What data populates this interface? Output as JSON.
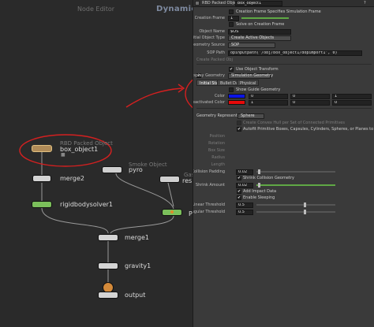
{
  "network": {
    "path_label": "Node Editor",
    "context_label": "Dynamics",
    "nodes": {
      "box_object": {
        "type": "RBD Packed Object",
        "name": "box_object1"
      },
      "smoke": {
        "type": "Smoke Object",
        "name": "pyro"
      },
      "resize": {
        "type": "Gas Re",
        "name": "resiz"
      },
      "merge2": {
        "name": "merge2"
      },
      "solver": {
        "name": "rigidbodysolver1"
      },
      "merge1": {
        "name": "merge1"
      },
      "gravity": {
        "name": "gravity1"
      },
      "output": {
        "name": "output"
      },
      "pyrosolver": {
        "name": "Py"
      }
    },
    "highlight_color": "#d42020",
    "solver_color": "#7bbf5b",
    "node_color": "#d4d4d4"
  },
  "panel": {
    "header": {
      "type_label": "RBD Packed Object",
      "node_name": "box_object1"
    },
    "creation_frame_toggle": "Creation Frame Specifies Simulation Frame",
    "creation_frame": {
      "label": "Creation Frame",
      "value": "1"
    },
    "solve_on_creation": "Solve on Creation Frame",
    "object_name": {
      "label": "Object Name",
      "value": "$OS"
    },
    "initial_object_type": {
      "label": "Initial Object Type",
      "value": "Create Active Objects"
    },
    "geometry_source": {
      "label": "Geometry Source",
      "value": "SOP"
    },
    "sop_path": {
      "label": "SOP Path",
      "value": "opinputpath('/obj/box_object1/dopimport1', 0)"
    },
    "create_from_label": "Create Packed Obj",
    "use_object_transform": "Use Object Transform",
    "display_geometry": {
      "label": "Display Geometry",
      "value": "Simulation Geometry"
    },
    "tabs": [
      "Initial State",
      "Bullet Data",
      "Physical"
    ],
    "show_guide": "Show Guide Geometry",
    "color": {
      "label": "Color",
      "values": [
        "0",
        "0",
        "1"
      ],
      "swatch": "#0a14e6"
    },
    "deactivated_color": {
      "label": "Deactivated Color",
      "values": [
        "1",
        "0",
        "0"
      ],
      "swatch": "#e60a0a"
    },
    "geometry_representation": {
      "label": "Geometry Representa",
      "value": "Sphere"
    },
    "convex_note": "Create Convex Hull per Set of Connected Primitives",
    "autofit_note": "Autofit Primitive Boxes, Capsules, Cylinders, Spheres, or Planes to Geometry",
    "dim_rows": [
      "Position",
      "Rotation",
      "Box Size",
      "Radius",
      "Length"
    ],
    "collision_padding": {
      "label": "Collision Padding",
      "value": "0.02"
    },
    "shrink_geometry": "Shrink Collision Geometry",
    "shrink_amount": {
      "label": "Shrink Amount",
      "value": "0.02"
    },
    "add_impact": "Add Impact Data",
    "enable_sleeping": "Enable Sleeping",
    "linear_threshold": {
      "label": "Linear Threshold",
      "value": "0.5"
    },
    "angular_threshold": {
      "label": "Angular Threshold",
      "value": "0.5"
    },
    "check_glyph": "✔"
  }
}
